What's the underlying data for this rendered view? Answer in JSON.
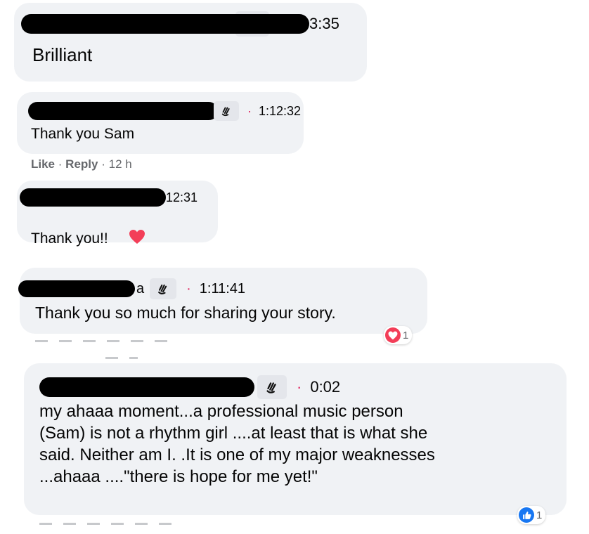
{
  "comments": [
    {
      "timestamp": "3:35",
      "text": "Brilliant"
    },
    {
      "timestamp": "1:12:32",
      "text": "Thank you Sam",
      "actions": {
        "like": "Like",
        "reply": "Reply",
        "age": "12 h"
      }
    },
    {
      "timestamp": "12:31",
      "text": "Thank you!!"
    },
    {
      "name_suffix": "a",
      "timestamp": "1:11:41",
      "text": "Thank you so much for sharing your story.",
      "reaction": {
        "icon": "love-reaction-icon",
        "count": "1"
      }
    },
    {
      "timestamp": "0:02",
      "text": "my ahaaa moment...a professional music person\n(Sam) is not a rhythm girl ....at least that is what she\nsaid. Neither am I. .It is one of my major weaknesses\n...ahaaa ....\"there is hope for me yet!\"",
      "reaction": {
        "icon": "like-reaction-icon",
        "count": "1"
      }
    }
  ],
  "separators": {
    "dot": "·"
  },
  "colors": {
    "bubble": "#f0f2f5",
    "timestamp_dot": "#e0245e",
    "like_blue": "#1877f2",
    "heart_red": "#f33e58"
  }
}
